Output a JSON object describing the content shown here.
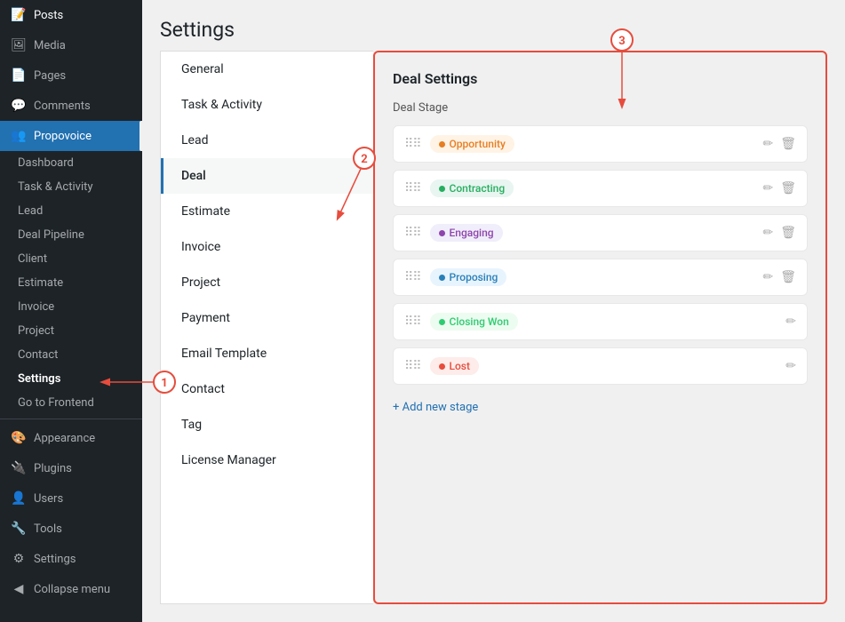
{
  "sidebar": {
    "items": [
      {
        "label": "Posts",
        "icon": "📝",
        "id": "posts"
      },
      {
        "label": "Media",
        "icon": "🖼",
        "id": "media"
      },
      {
        "label": "Pages",
        "icon": "📄",
        "id": "pages"
      },
      {
        "label": "Comments",
        "icon": "💬",
        "id": "comments"
      },
      {
        "label": "Propovoice",
        "icon": "👥",
        "id": "propovoice",
        "active": true
      }
    ],
    "propovoice_submenu": [
      {
        "label": "Dashboard",
        "id": "dashboard"
      },
      {
        "label": "Task & Activity",
        "id": "task-activity"
      },
      {
        "label": "Lead",
        "id": "lead"
      },
      {
        "label": "Deal Pipeline",
        "id": "deal-pipeline"
      },
      {
        "label": "Client",
        "id": "client"
      },
      {
        "label": "Estimate",
        "id": "estimate"
      },
      {
        "label": "Invoice",
        "id": "invoice"
      },
      {
        "label": "Project",
        "id": "project"
      },
      {
        "label": "Contact",
        "id": "contact"
      },
      {
        "label": "Settings",
        "id": "settings",
        "active": true
      },
      {
        "label": "Go to Frontend",
        "id": "frontend"
      }
    ],
    "bottom_items": [
      {
        "label": "Appearance",
        "icon": "🎨",
        "id": "appearance"
      },
      {
        "label": "Plugins",
        "icon": "🔌",
        "id": "plugins"
      },
      {
        "label": "Users",
        "icon": "👤",
        "id": "users"
      },
      {
        "label": "Tools",
        "icon": "🔧",
        "id": "tools"
      },
      {
        "label": "Settings",
        "icon": "⚙",
        "id": "wp-settings"
      },
      {
        "label": "Collapse menu",
        "icon": "◀",
        "id": "collapse"
      }
    ]
  },
  "settings_nav": {
    "items": [
      {
        "label": "General",
        "id": "general"
      },
      {
        "label": "Task & Activity",
        "id": "task-activity"
      },
      {
        "label": "Lead",
        "id": "lead"
      },
      {
        "label": "Deal",
        "id": "deal",
        "active": true
      },
      {
        "label": "Estimate",
        "id": "estimate"
      },
      {
        "label": "Invoice",
        "id": "invoice"
      },
      {
        "label": "Project",
        "id": "project"
      },
      {
        "label": "Payment",
        "id": "payment"
      },
      {
        "label": "Email Template",
        "id": "email-template"
      },
      {
        "label": "Contact",
        "id": "contact"
      },
      {
        "label": "Tag",
        "id": "tag"
      },
      {
        "label": "License Manager",
        "id": "license-manager"
      }
    ]
  },
  "deal_settings": {
    "title": "Deal Settings",
    "deal_stage_label": "Deal Stage",
    "stages": [
      {
        "label": "Opportunity",
        "badge_class": "badge-opportunity",
        "id": "opportunity"
      },
      {
        "label": "Contracting",
        "badge_class": "badge-contracting",
        "id": "contracting"
      },
      {
        "label": "Engaging",
        "badge_class": "badge-engaging",
        "id": "engaging"
      },
      {
        "label": "Proposing",
        "badge_class": "badge-proposing",
        "id": "proposing"
      },
      {
        "label": "Closing Won",
        "badge_class": "badge-closing",
        "id": "closing-won"
      },
      {
        "label": "Lost",
        "badge_class": "badge-lost",
        "id": "lost"
      }
    ],
    "add_stage_label": "+ Add new stage"
  },
  "annotations": {
    "circle_1": "1",
    "circle_2": "2",
    "circle_3": "3"
  },
  "page_title": "Settings"
}
